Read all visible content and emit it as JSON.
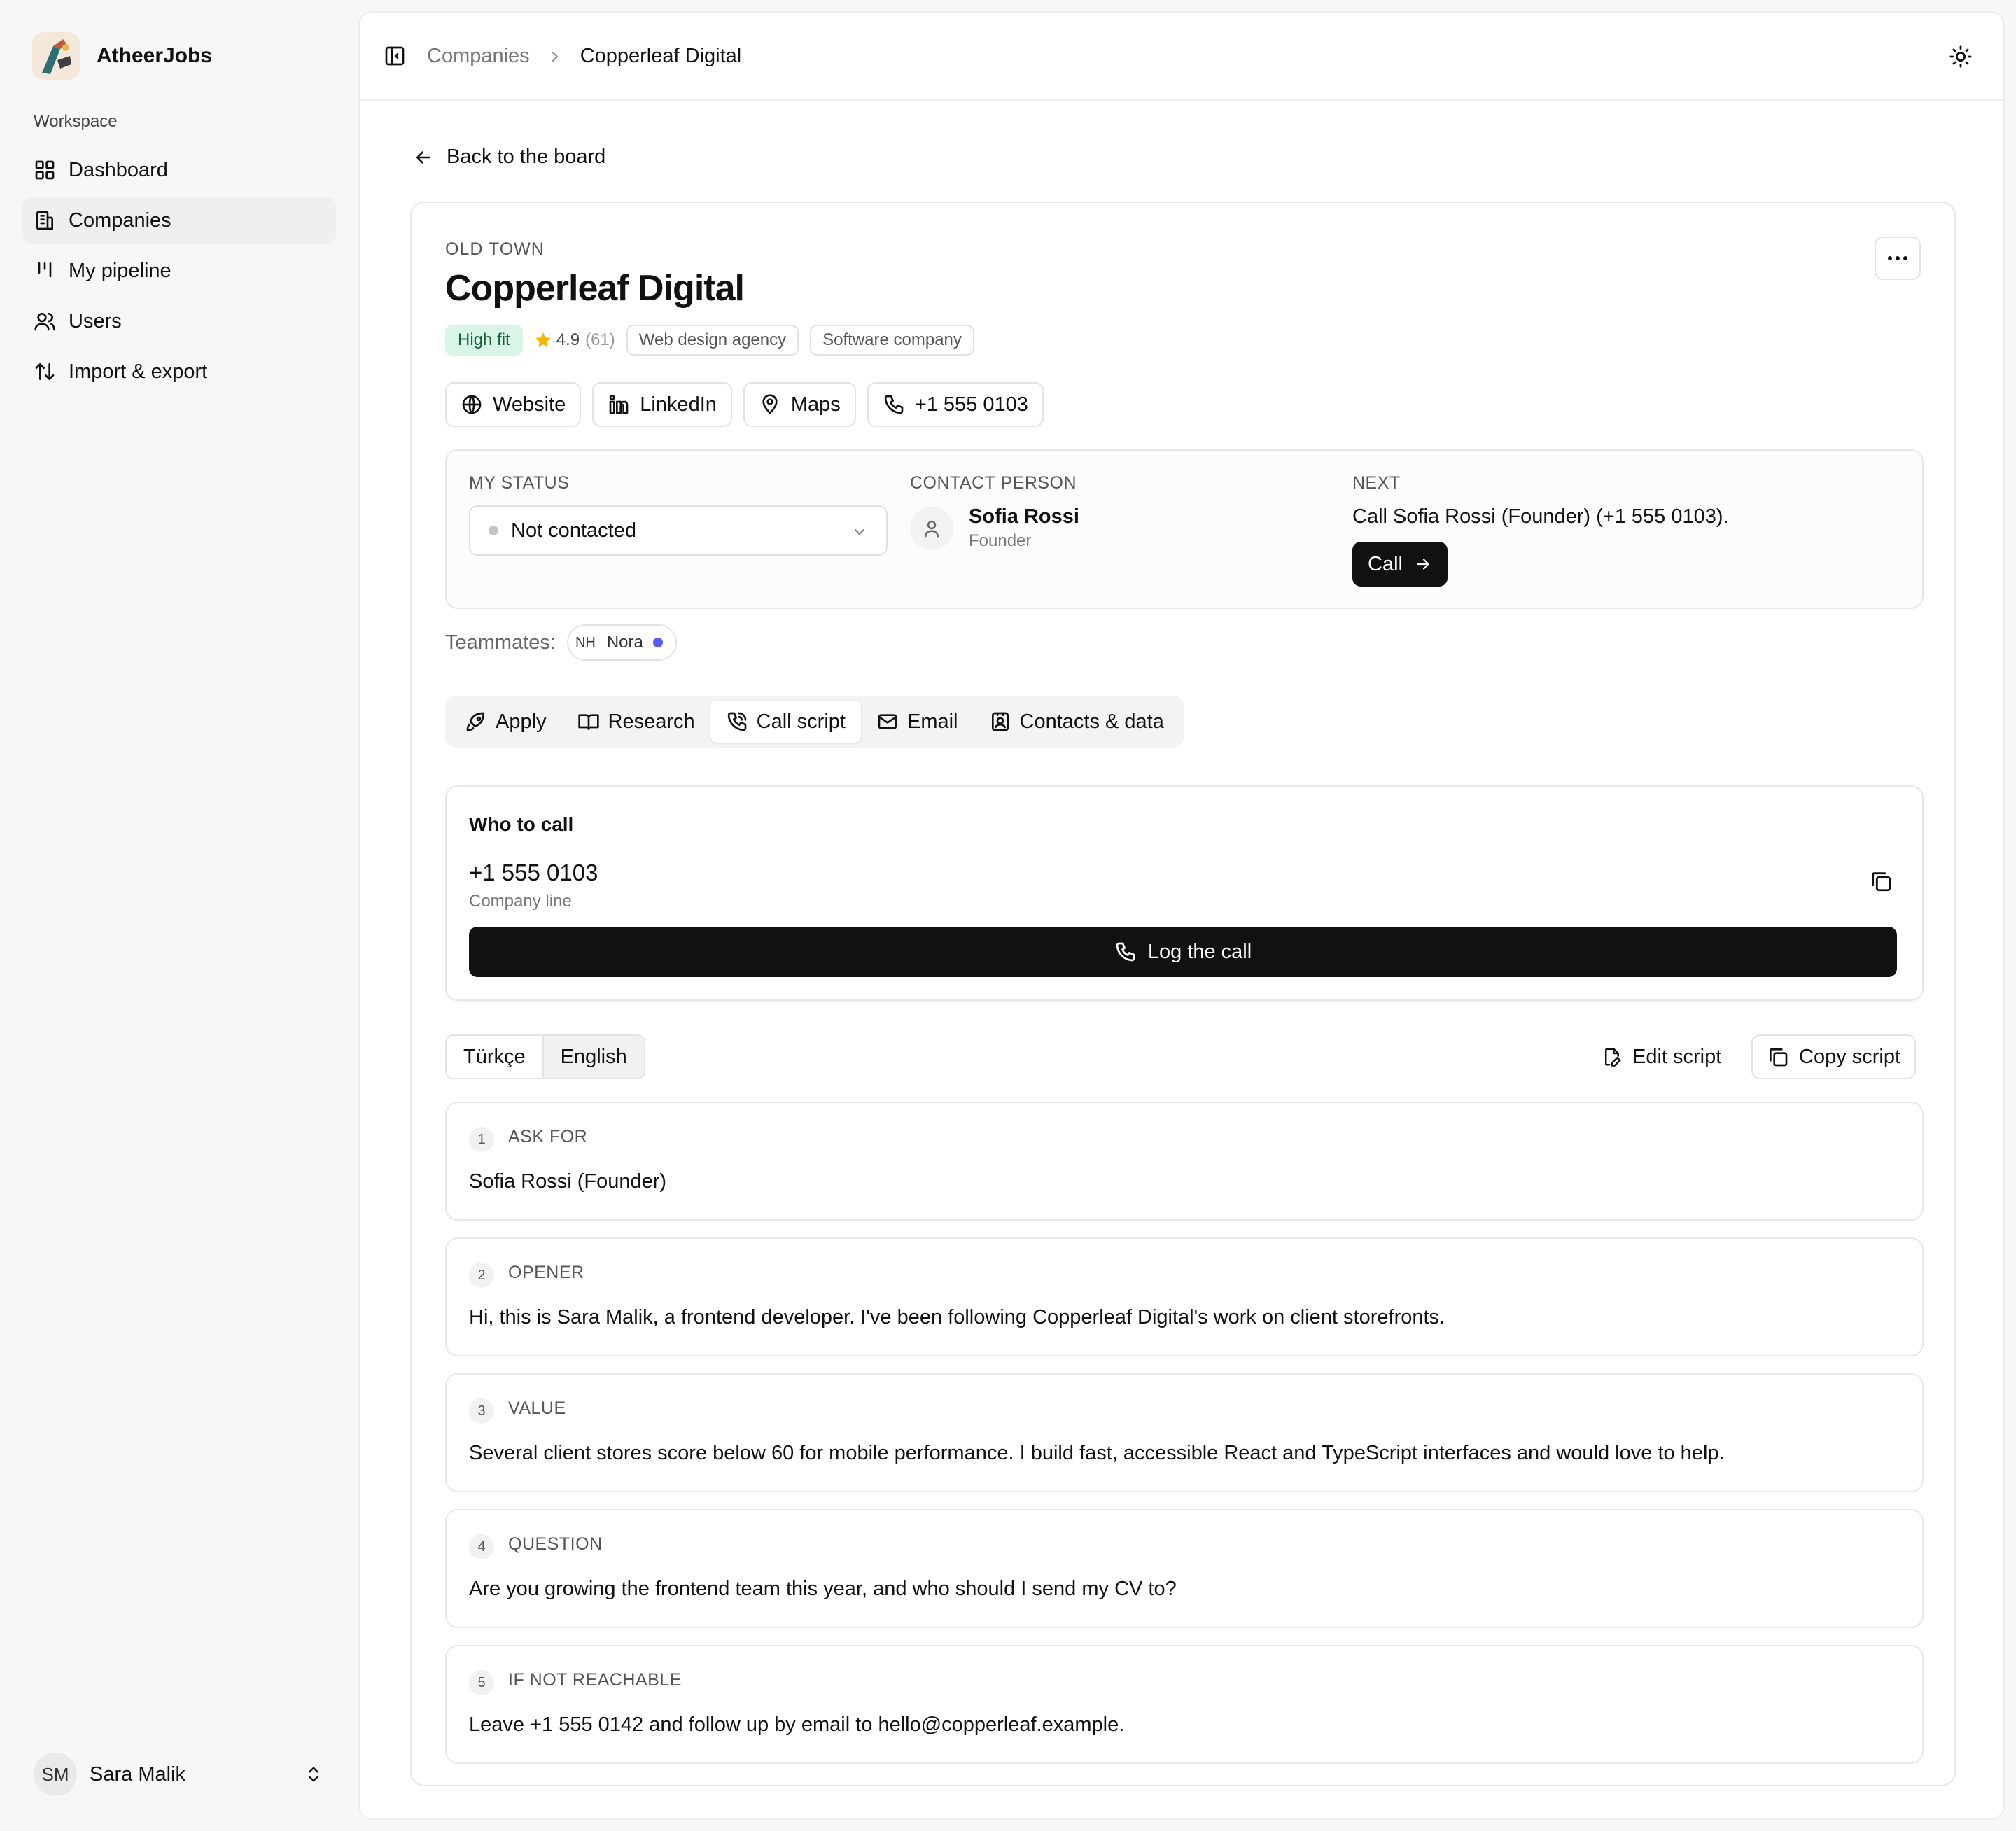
{
  "app": {
    "name": "AtheerJobs"
  },
  "sidebar": {
    "section_label": "Workspace",
    "items": [
      {
        "label": "Dashboard",
        "icon": "dashboard-icon"
      },
      {
        "label": "Companies",
        "icon": "building-icon",
        "active": true
      },
      {
        "label": "My pipeline",
        "icon": "pipeline-icon"
      },
      {
        "label": "Users",
        "icon": "users-icon"
      },
      {
        "label": "Import & export",
        "icon": "sort-arrows-icon"
      }
    ],
    "user": {
      "initials": "SM",
      "name": "Sara Malik"
    }
  },
  "breadcrumb": {
    "parent": "Companies",
    "current": "Copperleaf Digital"
  },
  "back_label": "Back to the board",
  "company": {
    "region": "OLD TOWN",
    "name": "Copperleaf Digital",
    "fit": "High fit",
    "rating": "4.9",
    "rating_count": "(61)",
    "tags": [
      "Web design agency",
      "Software company"
    ],
    "links": [
      {
        "label": "Website",
        "icon": "globe-icon"
      },
      {
        "label": "LinkedIn",
        "icon": "linkedin-icon"
      },
      {
        "label": "Maps",
        "icon": "map-pin-icon"
      },
      {
        "label": "+1 555 0103",
        "icon": "phone-icon"
      }
    ]
  },
  "status_panel": {
    "status_label": "MY STATUS",
    "status_value": "Not contacted",
    "contact_label": "CONTACT PERSON",
    "contact_name": "Sofia Rossi",
    "contact_role": "Founder",
    "next_label": "NEXT",
    "next_text": "Call Sofia Rossi (Founder) (+1 555 0103).",
    "call_button": "Call"
  },
  "teammates": {
    "label": "Teammates:",
    "initials": "NH",
    "name": "Nora"
  },
  "tabs": [
    {
      "label": "Apply",
      "icon": "rocket-icon"
    },
    {
      "label": "Research",
      "icon": "book-icon"
    },
    {
      "label": "Call script",
      "icon": "phone-call-icon",
      "active": true
    },
    {
      "label": "Email",
      "icon": "mail-icon"
    },
    {
      "label": "Contacts & data",
      "icon": "contact-card-icon"
    }
  ],
  "who_to_call": {
    "title": "Who to call",
    "number": "+1 555 0103",
    "sub": "Company line",
    "log_button": "Log the call"
  },
  "script": {
    "languages": [
      "Türkçe",
      "English"
    ],
    "active_language": "English",
    "edit_label": "Edit script",
    "copy_label": "Copy script",
    "steps": [
      {
        "num": "1",
        "label": "ASK FOR",
        "text": "Sofia Rossi (Founder)"
      },
      {
        "num": "2",
        "label": "OPENER",
        "text": "Hi, this is Sara Malik, a frontend developer. I've been following Copperleaf Digital's work on client storefronts."
      },
      {
        "num": "3",
        "label": "VALUE",
        "text": "Several client stores score below 60 for mobile performance. I build fast, accessible React and TypeScript interfaces and would love to help."
      },
      {
        "num": "4",
        "label": "QUESTION",
        "text": "Are you growing the frontend team this year, and who should I send my CV to?"
      },
      {
        "num": "5",
        "label": "IF NOT REACHABLE",
        "text": "Leave +1 555 0142 and follow up by email to hello@copperleaf.example."
      }
    ]
  },
  "colors": {
    "accent_dark": "#111111",
    "fit_bg": "#d9f5e7",
    "fit_text": "#17603e",
    "star": "#f5b301",
    "online": "#5b5bf5"
  }
}
